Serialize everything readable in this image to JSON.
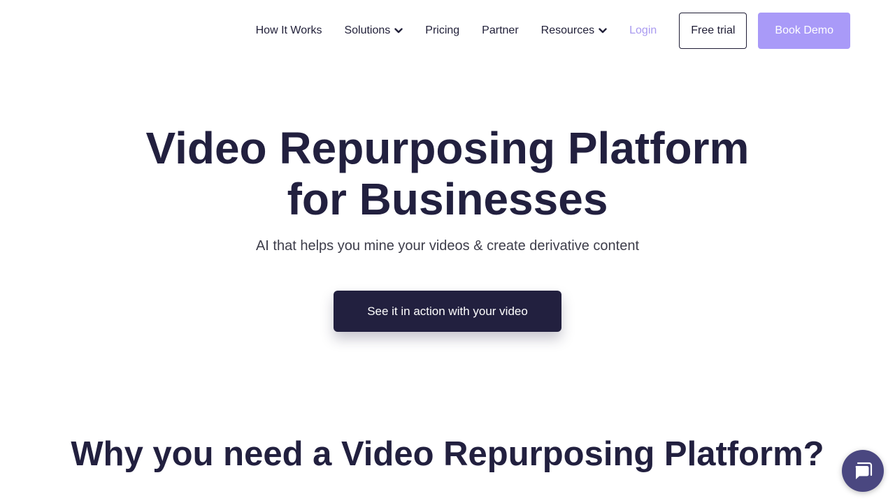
{
  "nav": {
    "items": [
      {
        "label": "How It Works",
        "dropdown": false
      },
      {
        "label": "Solutions",
        "dropdown": true
      },
      {
        "label": "Pricing",
        "dropdown": false
      },
      {
        "label": "Partner",
        "dropdown": false
      },
      {
        "label": "Resources",
        "dropdown": true
      }
    ],
    "login": "Login",
    "free_trial": "Free trial",
    "book_demo": "Book Demo"
  },
  "hero": {
    "title_line1": "Video Repurposing Platform",
    "title_line2": "for Businesses",
    "subtitle": "AI that helps you mine your videos & create derivative content",
    "cta": "See it in action with your video"
  },
  "why": {
    "title": "Why you need a Video Repurposing Platform?"
  },
  "colors": {
    "primary_dark": "#22203f",
    "accent_purple": "#a99af8",
    "login_text": "#a99af0",
    "chat_bubble": "#4a4780"
  },
  "icons": {
    "dropdown": "chevron-down-icon",
    "chat": "chat-icon"
  }
}
